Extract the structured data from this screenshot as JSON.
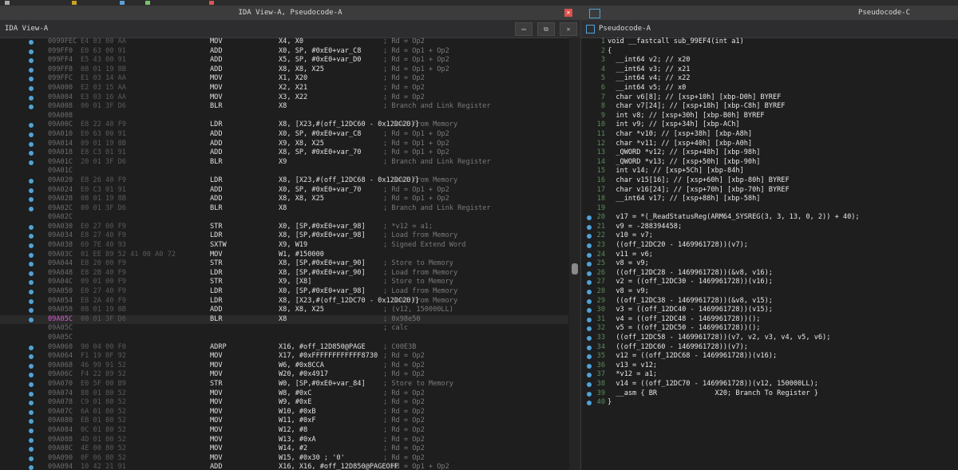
{
  "left": {
    "title": "IDA View-A, Pseudocode-A",
    "close_glyph": "✕",
    "tab": "IDA View-A",
    "btn1": "▭",
    "btn2": "⧉",
    "btn3": "✕",
    "rows": [
      {
        "a": "0099FEC",
        "b": "E4 03 00 AA",
        "m": "MOV",
        "o": "X4, X0",
        "c": "; Rd = Op2",
        "dot": true
      },
      {
        "a": "099FF0",
        "b": "E0 63 00 91",
        "m": "ADD",
        "o": "X0, SP, #0xE0+var_C8",
        "c": "; Rd = Op1 + Op2",
        "dot": true
      },
      {
        "a": "099FF4",
        "b": "E5 43 00 91",
        "m": "ADD",
        "o": "X5, SP, #0xE0+var_D0",
        "c": "; Rd = Op1 + Op2",
        "dot": true
      },
      {
        "a": "099FF8",
        "b": "08 01 19 8B",
        "m": "ADD",
        "o": "X8, X8, X25",
        "c": "; Rd = Op1 + Op2",
        "dot": true
      },
      {
        "a": "099FFC",
        "b": "E1 03 14 AA",
        "m": "MOV",
        "o": "X1, X20",
        "c": "; Rd = Op2",
        "dot": true
      },
      {
        "a": "09A000",
        "b": "E2 03 15 AA",
        "m": "MOV",
        "o": "X2, X21",
        "c": "; Rd = Op2",
        "dot": true
      },
      {
        "a": "09A004",
        "b": "E3 03 16 AA",
        "m": "MOV",
        "o": "X3, X22",
        "c": "; Rd = Op2",
        "dot": true
      },
      {
        "a": "09A008",
        "b": "00 01 3F D6",
        "m": "BLR",
        "o": "X8",
        "c": "; Branch and Link Register",
        "dot": true
      },
      {
        "a": "09A008",
        "b": "",
        "m": "",
        "o": "",
        "c": "",
        "dot": false
      },
      {
        "a": "09A00C",
        "b": "E8 22 40 F9",
        "m": "LDR",
        "o": "X8, [X23,#(off_12DC60 - 0x12DC20)]",
        "c": "; Load from Memory",
        "dot": true
      },
      {
        "a": "09A010",
        "b": "E0 63 00 91",
        "m": "ADD",
        "o": "X0, SP, #0xE0+var_C8",
        "c": "; Rd = Op1 + Op2",
        "dot": true
      },
      {
        "a": "09A014",
        "b": "09 01 19 8B",
        "m": "ADD",
        "o": "X9, X8, X25",
        "c": "; Rd = Op1 + Op2",
        "dot": true
      },
      {
        "a": "09A018",
        "b": "E8 C3 01 91",
        "m": "ADD",
        "o": "X8, SP, #0xE0+var_70",
        "c": "; Rd = Op1 + Op2",
        "dot": true
      },
      {
        "a": "09A01C",
        "b": "20 01 3F D6",
        "m": "BLR",
        "o": "X9",
        "c": "; Branch and Link Register",
        "dot": true
      },
      {
        "a": "09A01C",
        "b": "",
        "m": "",
        "o": "",
        "c": "",
        "dot": false
      },
      {
        "a": "09A020",
        "b": "E8 26 40 F9",
        "m": "LDR",
        "o": "X8, [X23,#(off_12DC68 - 0x12DC20)]",
        "c": "; Load from Memory",
        "dot": true
      },
      {
        "a": "09A024",
        "b": "E0 C3 01 91",
        "m": "ADD",
        "o": "X0, SP, #0xE0+var_70",
        "c": "; Rd = Op1 + Op2",
        "dot": true
      },
      {
        "a": "09A028",
        "b": "08 01 19 8B",
        "m": "ADD",
        "o": "X8, X8, X25",
        "c": "; Rd = Op1 + Op2",
        "dot": true
      },
      {
        "a": "09A02C",
        "b": "00 01 3F D6",
        "m": "BLR",
        "o": "X8",
        "c": "; Branch and Link Register",
        "dot": true
      },
      {
        "a": "09A02C",
        "b": "",
        "m": "",
        "o": "",
        "c": "",
        "dot": false
      },
      {
        "a": "09A030",
        "b": "E0 27 00 F9",
        "m": "STR",
        "o": "X0, [SP,#0xE0+var_98]",
        "c": "; *v12 = a1;",
        "dot": true
      },
      {
        "a": "09A034",
        "b": "E8 27 40 F9",
        "m": "LDR",
        "o": "X8, [SP,#0xE0+var_98]",
        "c": "; Load from Memory",
        "dot": true
      },
      {
        "a": "09A038",
        "b": "69 7E 40 93",
        "m": "SXTW",
        "o": "X9, W19",
        "c": "; Signed Extend Word",
        "dot": true
      },
      {
        "a": "09A03C",
        "b": "01 EE 89 52 41 00 A0 72",
        "m": "MOV",
        "o": "W1, #150000",
        "c": "",
        "dot": true
      },
      {
        "a": "09A044",
        "b": "E8 20 00 F9",
        "m": "STR",
        "o": "X8, [SP,#0xE0+var_90]",
        "c": "; Store to Memory",
        "dot": true
      },
      {
        "a": "09A048",
        "b": "E8 2B 40 F9",
        "m": "LDR",
        "o": "X8, [SP,#0xE0+var_90]",
        "c": "; Load from Memory",
        "dot": true
      },
      {
        "a": "09A04C",
        "b": "09 01 00 F9",
        "m": "STR",
        "o": "X9, [X8]",
        "c": "; Store to Memory",
        "dot": true
      },
      {
        "a": "09A050",
        "b": "E0 27 40 F9",
        "m": "LDR",
        "o": "X0, [SP,#0xE0+var_98]",
        "c": "; Load from Memory",
        "dot": true
      },
      {
        "a": "09A054",
        "b": "E8 2A 40 F9",
        "m": "LDR",
        "o": "X8, [X23,#(off_12DC70 - 0x12DC20)]",
        "c": "; Load from Memory",
        "dot": true
      },
      {
        "a": "09A058",
        "b": "08 01 19 8B",
        "m": "ADD",
        "o": "X8, X8, X25",
        "c": "; (v12, 150000LL)",
        "dot": true
      },
      {
        "a": "09A05C",
        "b": "00 01 3F D6",
        "m": "BLR",
        "o": "X8",
        "c": "; 0x98e50",
        "dot": true,
        "hl": true
      },
      {
        "a": "09A05C",
        "b": "",
        "m": "",
        "o": "",
        "c": "; calc",
        "dot": false
      },
      {
        "a": "09A05C",
        "b": "",
        "m": "",
        "o": "",
        "c": "",
        "dot": false
      },
      {
        "a": "09A060",
        "b": "90 04 00 F0",
        "m": "ADRP",
        "o": "X16, #off_12D850@PAGE",
        "c": "; C00E3B",
        "dot": true
      },
      {
        "a": "09A064",
        "b": "F1 19 8F 92",
        "m": "MOV",
        "o": "X17, #0xFFFFFFFFFFFF8730",
        "c": "; Rd = Op2",
        "dot": true
      },
      {
        "a": "09A068",
        "b": "46 99 91 52",
        "m": "MOV",
        "o": "W6, #0x8CCA",
        "c": "; Rd = Op2",
        "dot": true
      },
      {
        "a": "09A06C",
        "b": "F4 22 89 52",
        "m": "MOV",
        "o": "W20, #0x4917",
        "c": "; Rd = Op2",
        "dot": true
      },
      {
        "a": "09A070",
        "b": "E0 5F 00 B9",
        "m": "STR",
        "o": "W0, [SP,#0xE0+var_84]",
        "c": "; Store to Memory",
        "dot": true
      },
      {
        "a": "09A074",
        "b": "88 01 80 52",
        "m": "MOV",
        "o": "W8, #0xC",
        "c": "; Rd = Op2",
        "dot": true
      },
      {
        "a": "09A078",
        "b": "C9 01 80 52",
        "m": "MOV",
        "o": "W9, #0xE",
        "c": "; Rd = Op2",
        "dot": true
      },
      {
        "a": "09A07C",
        "b": "6A 01 80 52",
        "m": "MOV",
        "o": "W10, #0xB",
        "c": "; Rd = Op2",
        "dot": true
      },
      {
        "a": "09A080",
        "b": "EB 01 80 52",
        "m": "MOV",
        "o": "W11, #0xF",
        "c": "; Rd = Op2",
        "dot": true
      },
      {
        "a": "09A084",
        "b": "0C 01 80 52",
        "m": "MOV",
        "o": "W12, #8",
        "c": "; Rd = Op2",
        "dot": true
      },
      {
        "a": "09A088",
        "b": "4D 01 80 52",
        "m": "MOV",
        "o": "W13, #0xA",
        "c": "; Rd = Op2",
        "dot": true
      },
      {
        "a": "09A08C",
        "b": "4E 00 80 52",
        "m": "MOV",
        "o": "W14, #2",
        "c": "; Rd = Op2",
        "dot": true
      },
      {
        "a": "09A090",
        "b": "0F 06 80 52",
        "m": "MOV",
        "o": "W15, #0x30 ; '0'",
        "c": "; Rd = Op2",
        "dot": true
      },
      {
        "a": "09A094",
        "b": "10 42 21 91",
        "m": "ADD",
        "o": "X16, X16, #off_12D850@PAGEOFF",
        "c": "; Rd = Op1 + Op2",
        "dot": true
      }
    ]
  },
  "right": {
    "title": "Pseudocode-C",
    "tab": "Pseudocode-A",
    "lines": [
      {
        "n": "1",
        "s": "void __fastcall sub_99EF4(int a1)",
        "dot": false
      },
      {
        "n": "2",
        "s": "{",
        "dot": false
      },
      {
        "n": "3",
        "s": "  __int64 v2; // x20",
        "dot": false
      },
      {
        "n": "4",
        "s": "  __int64 v3; // x21",
        "dot": false
      },
      {
        "n": "5",
        "s": "  __int64 v4; // x22",
        "dot": false
      },
      {
        "n": "6",
        "s": "  __int64 v5; // x0",
        "dot": false
      },
      {
        "n": "7",
        "s": "  char v6[8]; // [xsp+10h] [xbp-D0h] BYREF",
        "dot": false
      },
      {
        "n": "8",
        "s": "  char v7[24]; // [xsp+18h] [xbp-C8h] BYREF",
        "dot": false
      },
      {
        "n": "9",
        "s": "  int v8; // [xsp+30h] [xbp-B0h] BYREF",
        "dot": false
      },
      {
        "n": "10",
        "s": "  int v9; // [xsp+34h] [xbp-ACh]",
        "dot": false
      },
      {
        "n": "11",
        "s": "  char *v10; // [xsp+38h] [xbp-A8h]",
        "dot": false
      },
      {
        "n": "12",
        "s": "  char *v11; // [xsp+40h] [xbp-A0h]",
        "dot": false
      },
      {
        "n": "13",
        "s": "  _QWORD *v12; // [xsp+48h] [xbp-98h]",
        "dot": false
      },
      {
        "n": "14",
        "s": "  _QWORD *v13; // [xsp+50h] [xbp-90h]",
        "dot": false
      },
      {
        "n": "15",
        "s": "  int v14; // [xsp+5Ch] [xbp-84h]",
        "dot": false
      },
      {
        "n": "16",
        "s": "  char v15[16]; // [xsp+60h] [xbp-80h] BYREF",
        "dot": false
      },
      {
        "n": "17",
        "s": "  char v16[24]; // [xsp+70h] [xbp-70h] BYREF",
        "dot": false
      },
      {
        "n": "18",
        "s": "  __int64 v17; // [xsp+88h] [xbp-58h]",
        "dot": false
      },
      {
        "n": "19",
        "s": "",
        "dot": false
      },
      {
        "n": "20",
        "s": "  v17 = *(_ReadStatusReg(ARM64_SYSREG(3, 3, 13, 0, 2)) + 40);",
        "dot": true
      },
      {
        "n": "21",
        "s": "  v9 = -288394458;",
        "dot": true
      },
      {
        "n": "22",
        "s": "  v10 = v7;",
        "dot": true
      },
      {
        "n": "23",
        "s": "  ((off_12DC20 - 1469961728))(v7);",
        "dot": true
      },
      {
        "n": "24",
        "s": "  v11 = v6;",
        "dot": true
      },
      {
        "n": "25",
        "s": "  v8 = v9;",
        "dot": true
      },
      {
        "n": "26",
        "s": "  ((off_12DC28 - 1469961728))(&v8, v16);",
        "dot": true
      },
      {
        "n": "27",
        "s": "  v2 = ((off_12DC30 - 1469961728))(v16);",
        "dot": true
      },
      {
        "n": "28",
        "s": "  v8 = v9;",
        "dot": true
      },
      {
        "n": "29",
        "s": "  ((off_12DC38 - 1469961728))(&v8, v15);",
        "dot": true
      },
      {
        "n": "30",
        "s": "  v3 = ((off_12DC40 - 1469961728))(v15);",
        "dot": true
      },
      {
        "n": "31",
        "s": "  v4 = ((off_12DC48 - 1469961728))();",
        "dot": true
      },
      {
        "n": "32",
        "s": "  v5 = ((off_12DC50 - 1469961728))();",
        "dot": true
      },
      {
        "n": "33",
        "s": "  ((off_12DC58 - 1469961728))(v7, v2, v3, v4, v5, v6);",
        "dot": true
      },
      {
        "n": "34",
        "s": "  ((off_12DC60 - 1469961728))(v7);",
        "dot": true
      },
      {
        "n": "35",
        "s": "  v12 = ((off_12DC68 - 1469961728))(v16);",
        "dot": true
      },
      {
        "n": "36",
        "s": "  v13 = v12;",
        "dot": true
      },
      {
        "n": "37",
        "s": "  *v12 = a1;",
        "dot": true
      },
      {
        "n": "38",
        "s": "  v14 = ((off_12DC70 - 1469961728))(v12, 150000LL);",
        "dot": true
      },
      {
        "n": "39",
        "s": "  __asm { BR              X20; Branch To Register }",
        "dot": true
      },
      {
        "n": "40",
        "s": "}",
        "dot": true
      }
    ]
  },
  "colors": {
    "accent": "#4fa3d8",
    "highlight_addr": "#d85bd8",
    "close": "#d9534f"
  }
}
